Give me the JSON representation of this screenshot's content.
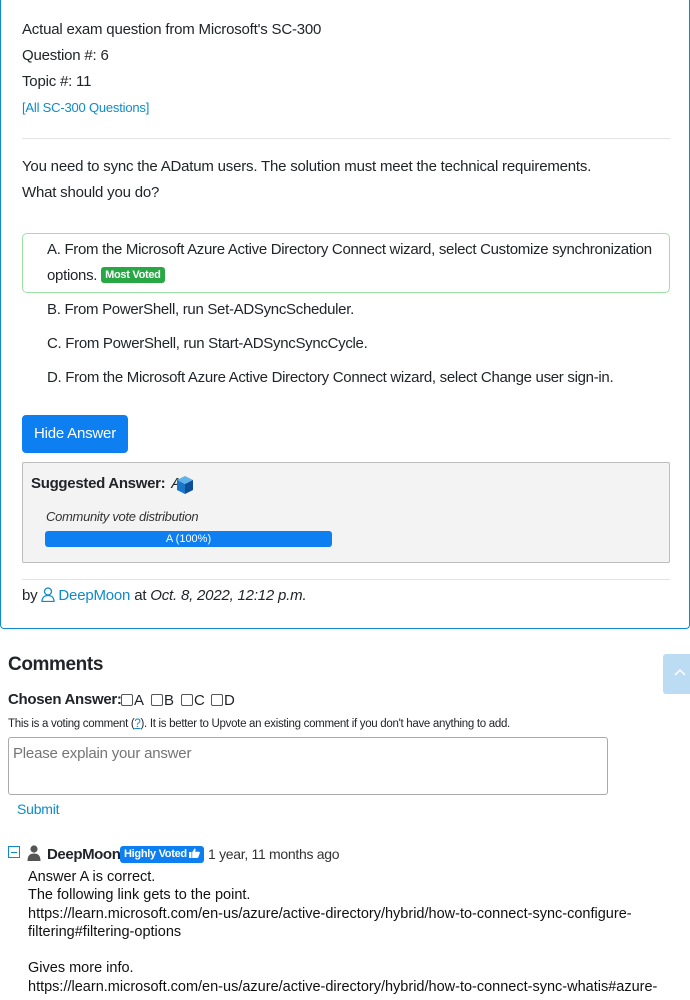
{
  "exam": {
    "line1": "Actual exam question from Microsoft's SC-300",
    "question_no": "Question #: 6",
    "topic_no": "Topic #: 11",
    "all_link": "[All SC-300 Questions]"
  },
  "question": {
    "line1": "You need to sync the ADatum users. The solution must meet the technical requirements.",
    "line2": "What should you do?"
  },
  "choices": {
    "a_line1": "A. From the Microsoft Azure Active Directory Connect wizard, select Customize synchronization",
    "a_line2": "options.",
    "a_badge": "Most Voted",
    "b": "B. From PowerShell, run Set-ADSyncScheduler.",
    "c": "C. From PowerShell, run Start-ADSyncSyncCycle.",
    "d": "D. From the Microsoft Azure Active Directory Connect wizard, select Change user sign-in."
  },
  "hide_answer_label": "Hide Answer",
  "answer": {
    "label": "Suggested Answer:",
    "value": "A",
    "community_label": "Community vote distribution",
    "vote_text": "A (100%)",
    "vote_fraction": 1.0
  },
  "byline": {
    "by": "by",
    "user": "DeepMoon",
    "at": "at",
    "date": "Oct. 8, 2022, 12:12 p.m."
  },
  "comments": {
    "heading": "Comments",
    "chosen_label": "Chosen Answer:",
    "options": [
      "A",
      "B",
      "C",
      "D"
    ],
    "note_pre": "This is a voting comment (",
    "note_link": "?",
    "note_post": "). It is better to Upvote an existing comment if you don't have anything to add.",
    "placeholder": "Please explain your answer",
    "submit": "Submit"
  },
  "comment1": {
    "user": "DeepMoon",
    "badge": "Highly Voted",
    "time": "1 year, 11 months ago",
    "line1": "Answer A is correct.",
    "line2": "The following link gets to the point.",
    "line3": "https://learn.microsoft.com/en-us/azure/active-directory/hybrid/how-to-connect-sync-configure-",
    "line4": "filtering#filtering-options",
    "line5": "Gives more info.",
    "line6": "https://learn.microsoft.com/en-us/azure/active-directory/hybrid/how-to-connect-sync-whatis#azure-"
  },
  "colors": {
    "accent": "#0e8bcb",
    "button": "#0d7ff0",
    "most_voted": "#28a745",
    "border_card": "#0e8bcb"
  }
}
